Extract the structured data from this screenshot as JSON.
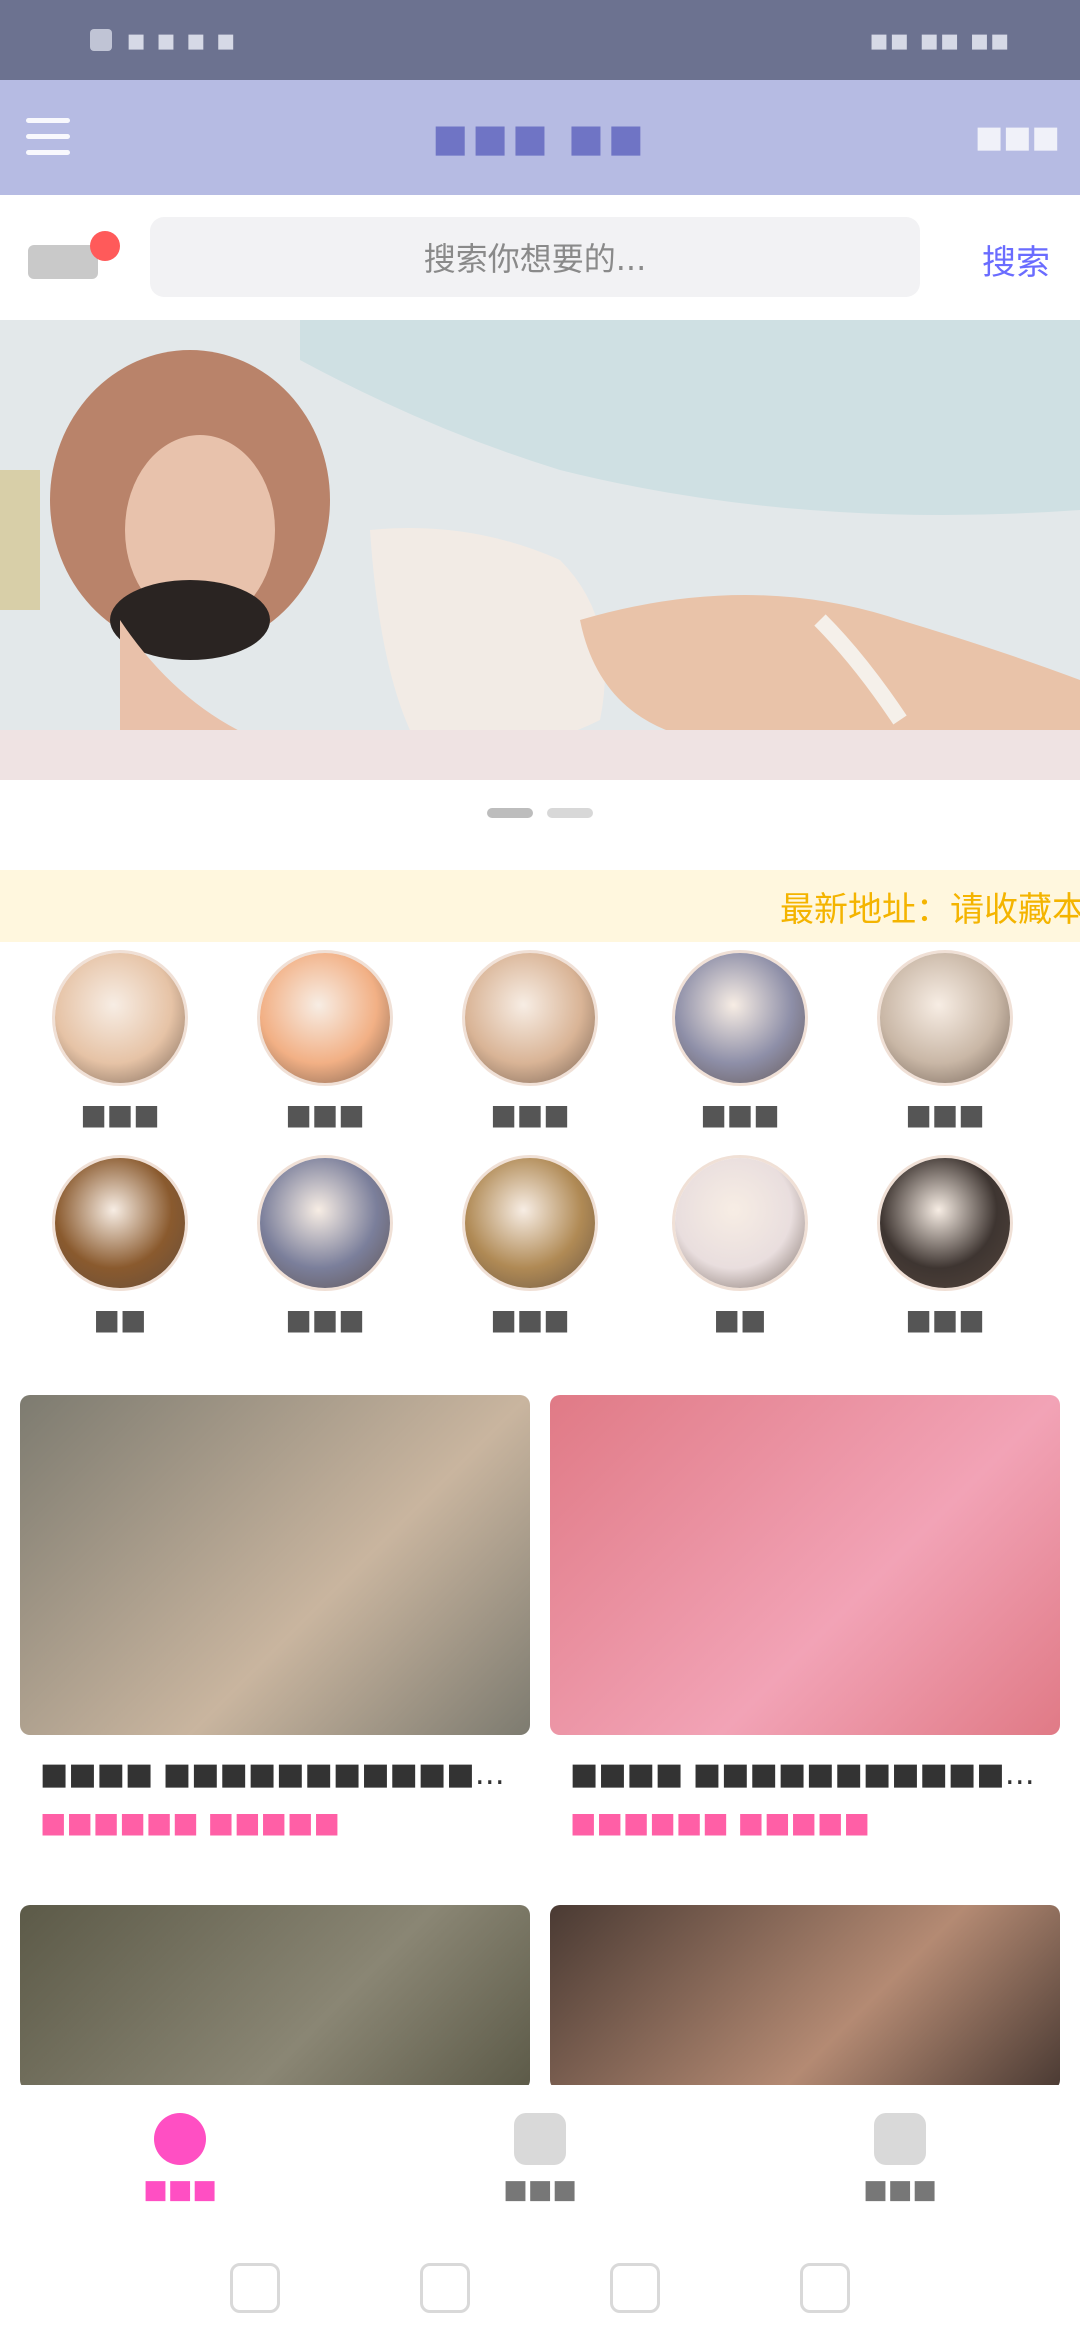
{
  "status_bar": {
    "left_text": "▪ ▪ ▪ ▪",
    "right_text": "▪▪ ▪▪ ▪▪"
  },
  "header": {
    "title": "■■■ ■■",
    "right_label": "■■■"
  },
  "search": {
    "placeholder": "搜索你想要的...",
    "button_label": "搜索"
  },
  "banner": {
    "dots": 2,
    "active_dot": 0
  },
  "notice": {
    "text": "最新地址：请收藏本站"
  },
  "categories": [
    {
      "label": "■■■",
      "color": "#e6c3a6"
    },
    {
      "label": "■■■",
      "color": "#f2b085"
    },
    {
      "label": "■■■",
      "color": "#d9b496"
    },
    {
      "label": "■■■",
      "color": "#8e8fa8"
    },
    {
      "label": "■■■",
      "color": "#c9b7a6"
    },
    {
      "label": "■■",
      "color": "#8a5a2e"
    },
    {
      "label": "■■■",
      "color": "#7b7f9b"
    },
    {
      "label": "■■■",
      "color": "#b08a55"
    },
    {
      "label": "■■",
      "color": "#e9dede"
    },
    {
      "label": "■■■",
      "color": "#3e3531"
    }
  ],
  "videos": [
    {
      "title": "■■■■ ■■■■■■■■■■■■■■■■■■■",
      "meta": "■■■■■■  ■■■■■",
      "colors": [
        "#7d7b70",
        "#c9b59f"
      ]
    },
    {
      "title": "■■■■ ■■■■■■■■■■■■■■■■■■",
      "meta": "■■■■■■  ■■■■■",
      "colors": [
        "#e07a86",
        "#f2a3b6"
      ]
    },
    {
      "title": "",
      "meta": "",
      "colors": [
        "#5c5a48",
        "#8a8674"
      ]
    },
    {
      "title": "",
      "meta": "",
      "colors": [
        "#4a3a33",
        "#b48a73"
      ]
    }
  ],
  "bottom_nav": [
    {
      "label": "■■■",
      "icon": "home-icon",
      "active": true
    },
    {
      "label": "■■■",
      "icon": "grid-icon",
      "active": false
    },
    {
      "label": "■■■",
      "icon": "user-icon",
      "active": false
    }
  ]
}
